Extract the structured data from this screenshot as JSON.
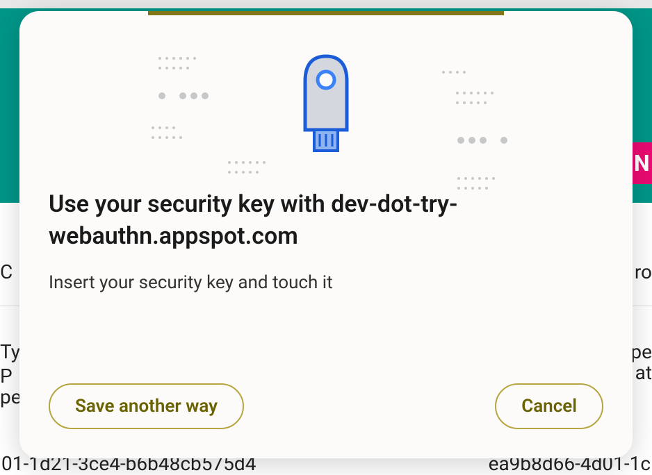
{
  "dialog": {
    "title": "Use your security key with dev-dot-try-webauthn.appspot.com",
    "subtitle": "Insert your security key and touch it",
    "save_another_way_label": "Save another way",
    "cancel_label": "Cancel"
  },
  "background": {
    "badge_letter": "N",
    "text_c": "C",
    "text_ro": "ro",
    "text_ty": "Ty",
    "text_p": "P",
    "text_pe": "pe",
    "text_pe2": "pe",
    "text_at": "at",
    "footer_left": "01-1d21-3ce4-b6b48cb575d4",
    "footer_right": "ea9b8d66-4d01-1c"
  },
  "colors": {
    "accent": "#827717",
    "button_border": "#b5a642",
    "button_text": "#6a6300",
    "bg_header": "#009688",
    "badge_bg": "#ec0a72"
  }
}
